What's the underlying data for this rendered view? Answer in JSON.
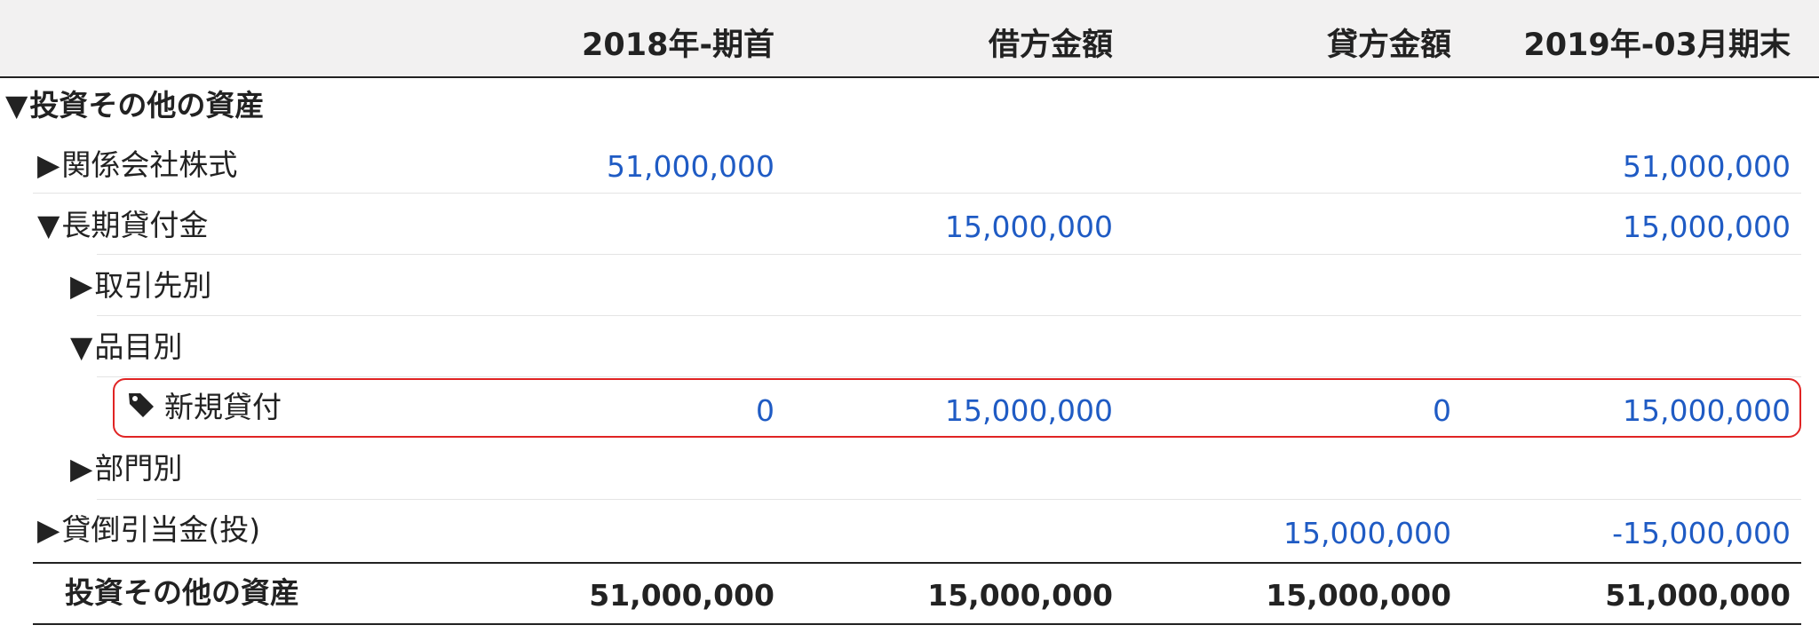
{
  "header": {
    "columns": [
      "2018年-期首",
      "借方金額",
      "貸方金額",
      "2019年-03月期末"
    ]
  },
  "rows": [
    {
      "label": "投資その他の資産",
      "marker": "▼",
      "values": [
        "",
        "",
        "",
        ""
      ]
    },
    {
      "label": "関係会社株式",
      "marker": "▶",
      "values": [
        "51,000,000",
        "",
        "",
        "51,000,000"
      ]
    },
    {
      "label": "長期貸付金",
      "marker": "▼",
      "values": [
        "",
        "15,000,000",
        "",
        "15,000,000"
      ]
    },
    {
      "label": "取引先別",
      "marker": "▶",
      "values": [
        "",
        "",
        "",
        ""
      ]
    },
    {
      "label": "品目別",
      "marker": "▼",
      "values": [
        "",
        "",
        "",
        ""
      ]
    },
    {
      "label": "新規貸付",
      "icon": "tag-icon",
      "values": [
        "0",
        "15,000,000",
        "0",
        "15,000,000"
      ]
    },
    {
      "label": "部門別",
      "marker": "▶",
      "values": [
        "",
        "",
        "",
        ""
      ]
    },
    {
      "label": "貸倒引当金(投)",
      "marker": "▶",
      "values": [
        "",
        "",
        "15,000,000",
        "-15,000,000"
      ]
    }
  ],
  "total": {
    "label": "投資その他の資産",
    "values": [
      "51,000,000",
      "15,000,000",
      "15,000,000",
      "51,000,000"
    ]
  },
  "colors": {
    "link": "#1f5bc4",
    "highlight_border": "#e02424",
    "header_bg": "#f2f1f1"
  }
}
